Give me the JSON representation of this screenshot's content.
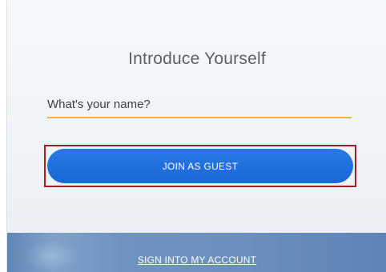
{
  "dialog": {
    "title": "Introduce Yourself",
    "name_field": {
      "placeholder": "What's your name?",
      "value": ""
    },
    "join_button_label": "JOIN AS GUEST",
    "signin_link_label": "SIGN INTO MY ACCOUNT"
  },
  "colors": {
    "accent_underline": "#f0b642",
    "button_blue": "#1a66d6",
    "highlight_border": "#a41c24",
    "footer_blue": "#6a90be"
  }
}
